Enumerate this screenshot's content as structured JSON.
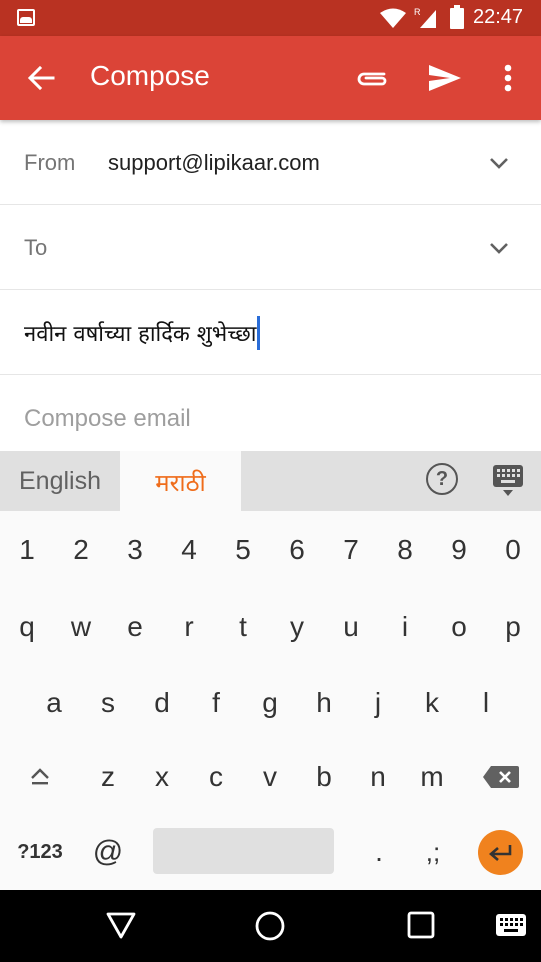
{
  "status_bar": {
    "time": "22:47",
    "icons": [
      "image-notification-icon",
      "wifi-icon",
      "roaming-signal-icon",
      "battery-icon"
    ],
    "roaming_indicator": "R"
  },
  "app_bar": {
    "title": "Compose",
    "back_icon": "arrow-back-icon",
    "actions": [
      "attach-icon",
      "send-icon",
      "more-vert-icon"
    ],
    "color": "#db4437"
  },
  "form": {
    "from_label": "From",
    "from_value": "support@lipikaar.com",
    "to_label": "To",
    "to_value": "",
    "subject_value": "नवीन वर्षाच्या हार्दिक शुभेच्छा",
    "body_placeholder": "Compose email"
  },
  "keyboard": {
    "tabs": [
      {
        "label": "English",
        "active": false
      },
      {
        "label": "मराठी",
        "active": true
      }
    ],
    "accent_color": "#ef6c1a",
    "number_row": [
      "1",
      "2",
      "3",
      "4",
      "5",
      "6",
      "7",
      "8",
      "9",
      "0"
    ],
    "row1": [
      "q",
      "w",
      "e",
      "r",
      "t",
      "y",
      "u",
      "i",
      "o",
      "p"
    ],
    "row2": [
      "a",
      "s",
      "d",
      "f",
      "g",
      "h",
      "j",
      "k",
      "l"
    ],
    "row3": [
      "z",
      "x",
      "c",
      "v",
      "b",
      "n",
      "m"
    ],
    "bottom": {
      "symbols": "?123",
      "at": "@",
      "period": ".",
      "punct": ",;"
    }
  },
  "nav_bar": {
    "buttons": [
      "back-triangle-icon",
      "home-circle-icon",
      "recents-square-icon",
      "keyboard-switch-icon"
    ]
  }
}
